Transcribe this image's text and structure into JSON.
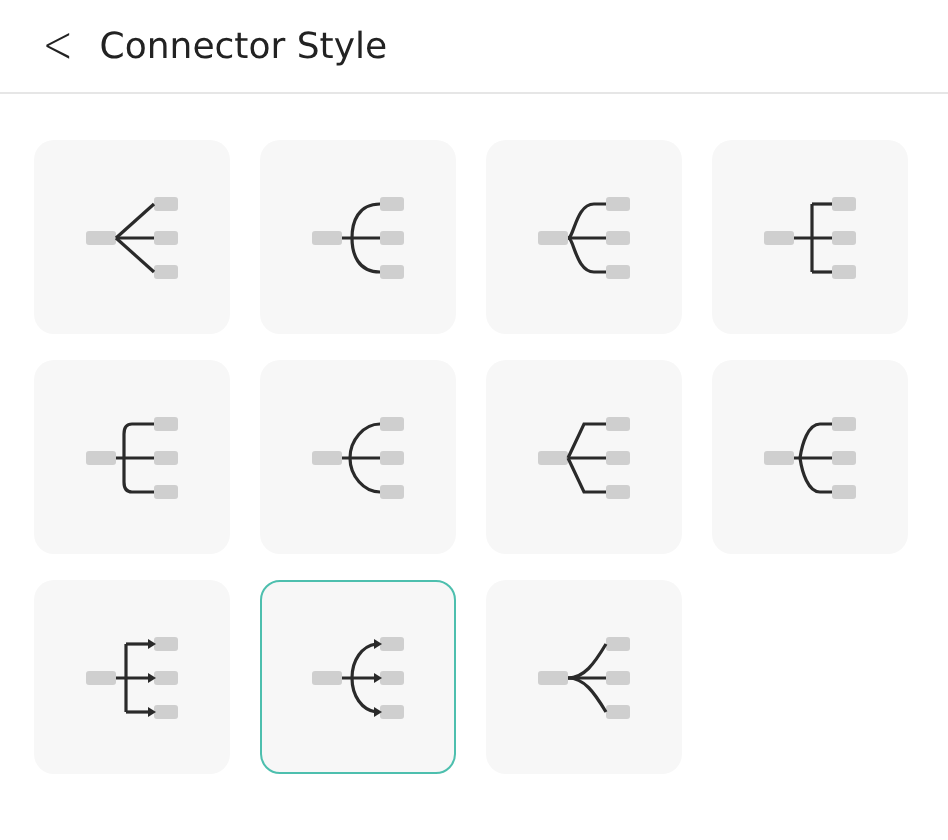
{
  "header": {
    "back_icon": "<",
    "title": "Connector Style"
  },
  "styles": [
    {
      "kind": "straight",
      "selected": false
    },
    {
      "kind": "round",
      "selected": false
    },
    {
      "kind": "bend",
      "selected": false
    },
    {
      "kind": "elbow",
      "selected": false
    },
    {
      "kind": "soft-elbow",
      "selected": false
    },
    {
      "kind": "arc",
      "selected": false
    },
    {
      "kind": "angled",
      "selected": false
    },
    {
      "kind": "soft-angled",
      "selected": false
    },
    {
      "kind": "arrow-elbow",
      "selected": false
    },
    {
      "kind": "arrow-arc",
      "selected": true
    },
    {
      "kind": "taper",
      "selected": false
    }
  ]
}
